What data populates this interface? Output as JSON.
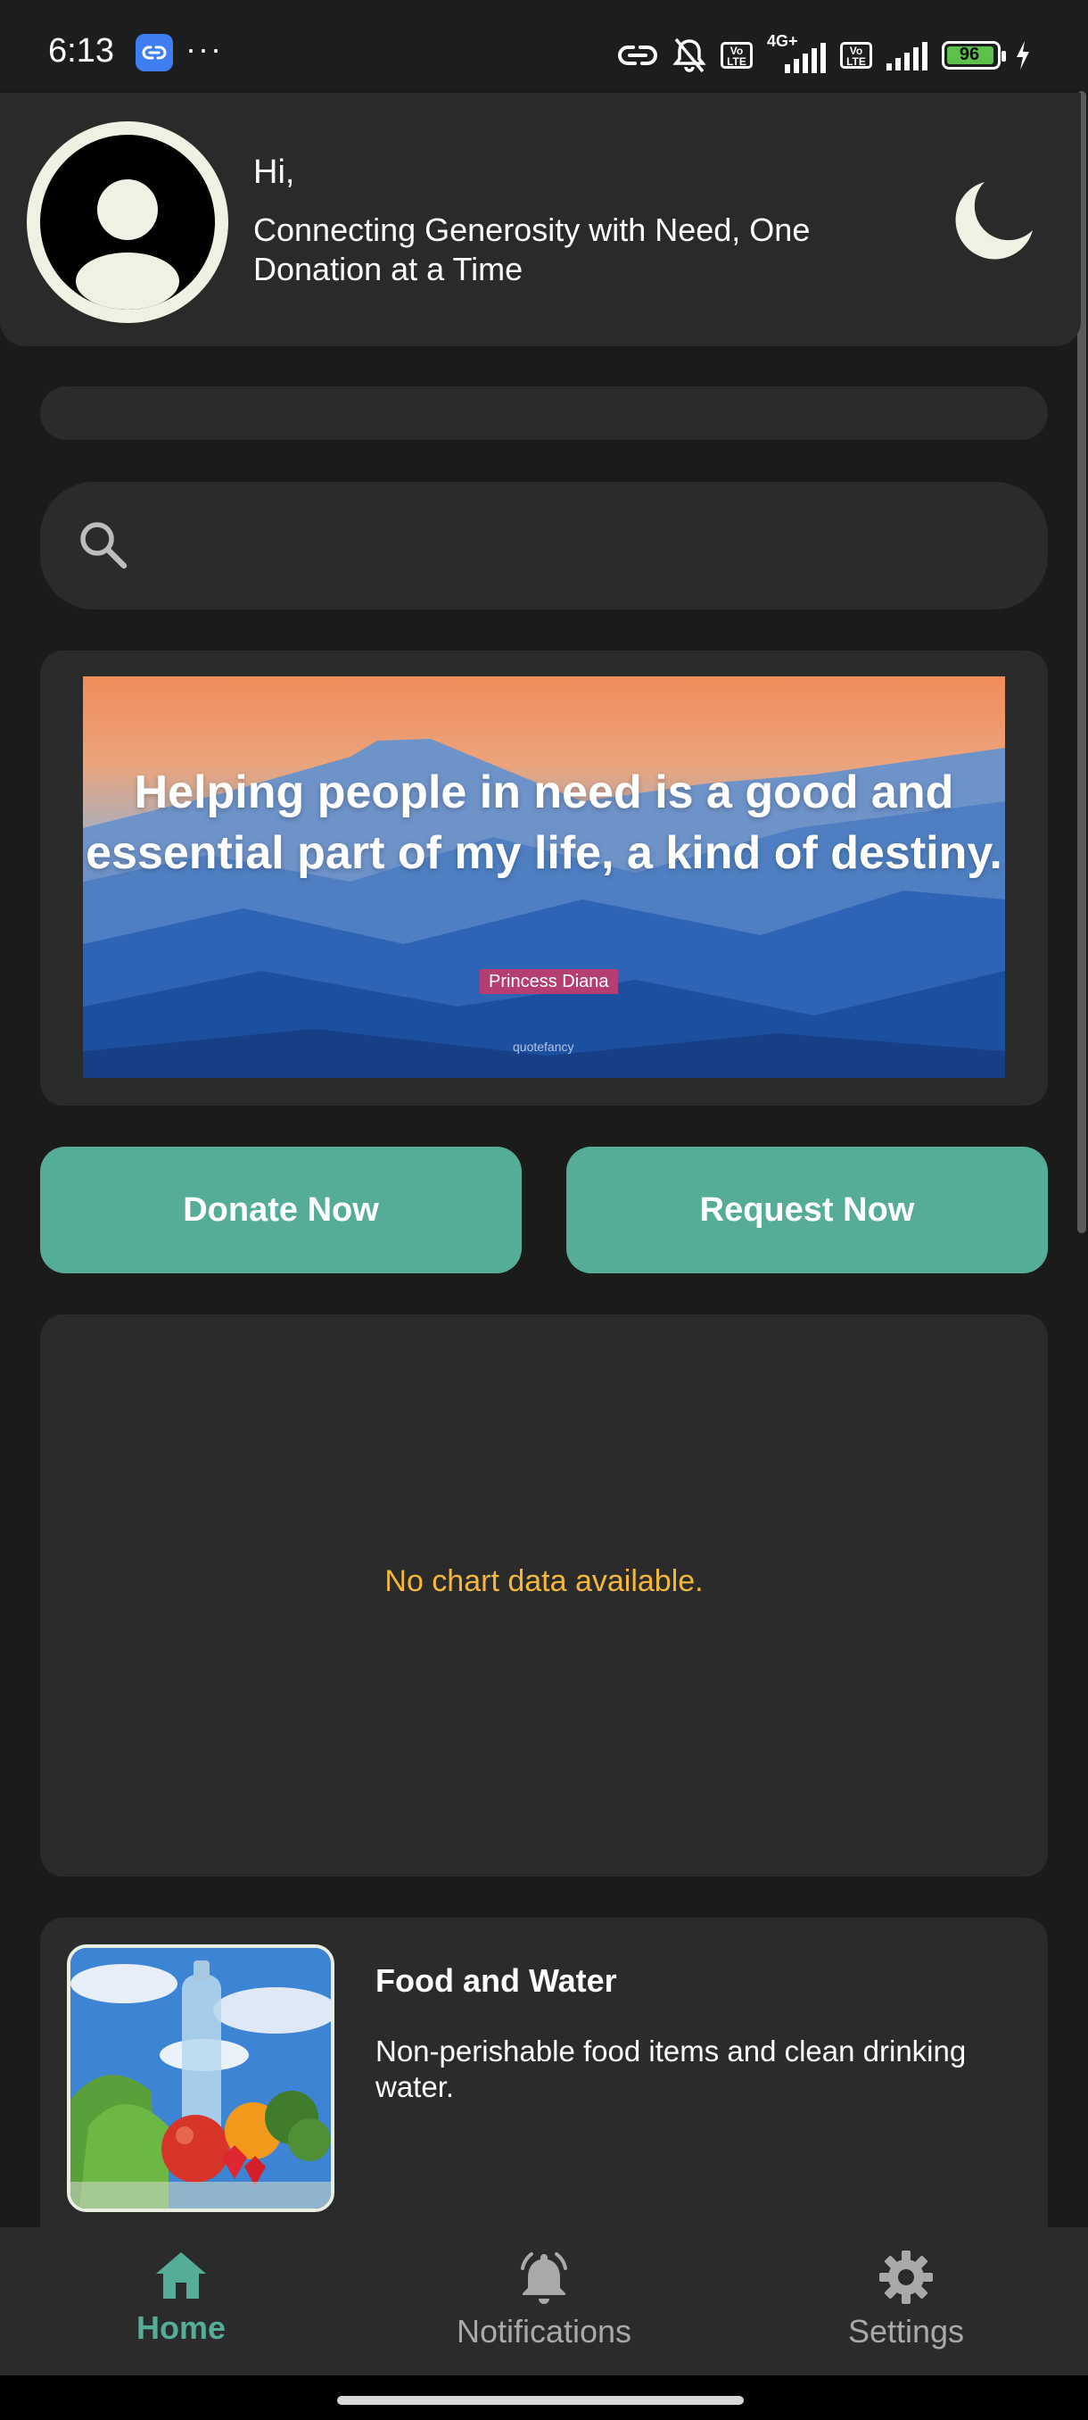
{
  "status_bar": {
    "time": "6:13",
    "dots": "···",
    "network": "4G+",
    "volte_label": "Vo LTE",
    "battery": "96"
  },
  "header": {
    "greeting": "Hi,",
    "tagline": "Connecting Generosity with Need, One Donation at a Time",
    "avatar_icon": "person-avatar-icon",
    "theme_icon": "moon-icon"
  },
  "search": {
    "icon": "search-icon",
    "value": "",
    "placeholder": ""
  },
  "banner": {
    "quote": "Helping people in need is a good and essential part of my life, a kind of destiny.",
    "author": "Princess Diana",
    "watermark": "quotefancy"
  },
  "actions": {
    "donate_label": "Donate Now",
    "request_label": "Request Now"
  },
  "chart": {
    "empty_message": "No chart data available."
  },
  "categories": [
    {
      "title": "Food and Water",
      "description": "Non-perishable food items and clean drinking water."
    }
  ],
  "nav": {
    "home_label": "Home",
    "notifications_label": "Notifications",
    "settings_label": "Settings"
  },
  "colors": {
    "accent": "#55ad98",
    "background": "#1b1c1a",
    "card": "#2b2b2b",
    "warning_text": "#f2b73b"
  }
}
